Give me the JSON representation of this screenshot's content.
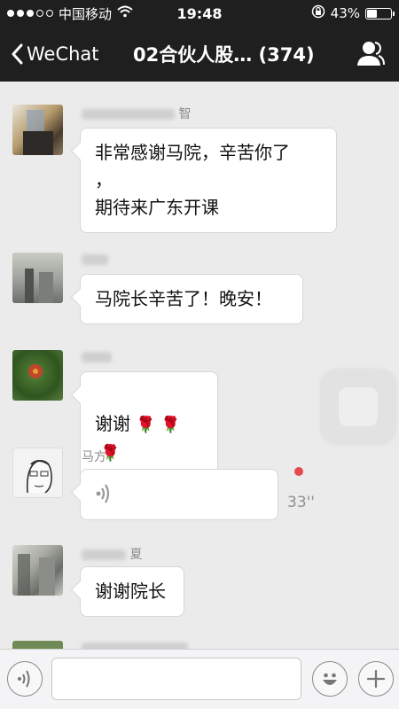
{
  "status_bar": {
    "carrier": "中国移动",
    "time": "19:48",
    "battery_percent": "43%",
    "battery_level": 0.43,
    "signal_bars_filled": 3,
    "signal_bars_total": 5
  },
  "nav": {
    "back_label": "WeChat",
    "title": "02合伙人股… (374)"
  },
  "messages": [
    {
      "sender": "智",
      "text": "非常感谢马院，辛苦你了\n，\n期待来广东开课"
    },
    {
      "sender": "",
      "text": "马院长辛苦了！晚安！"
    },
    {
      "sender": "",
      "text": "谢谢"
    },
    {
      "sender": "马方",
      "type": "voice",
      "duration": "33''",
      "unread": true
    },
    {
      "sender": "夏",
      "text": "谢谢院长"
    }
  ],
  "colors": {
    "bar_background": "#1f1f1f",
    "chat_background": "#ebebeb",
    "unread_dot": "#e5484d"
  },
  "icons": {
    "back": "chevron-left-icon",
    "contacts": "person-icon",
    "voice": "voice-wave-icon",
    "emoji": "smiley-icon",
    "add": "plus-icon",
    "flower": "rose-icon"
  }
}
